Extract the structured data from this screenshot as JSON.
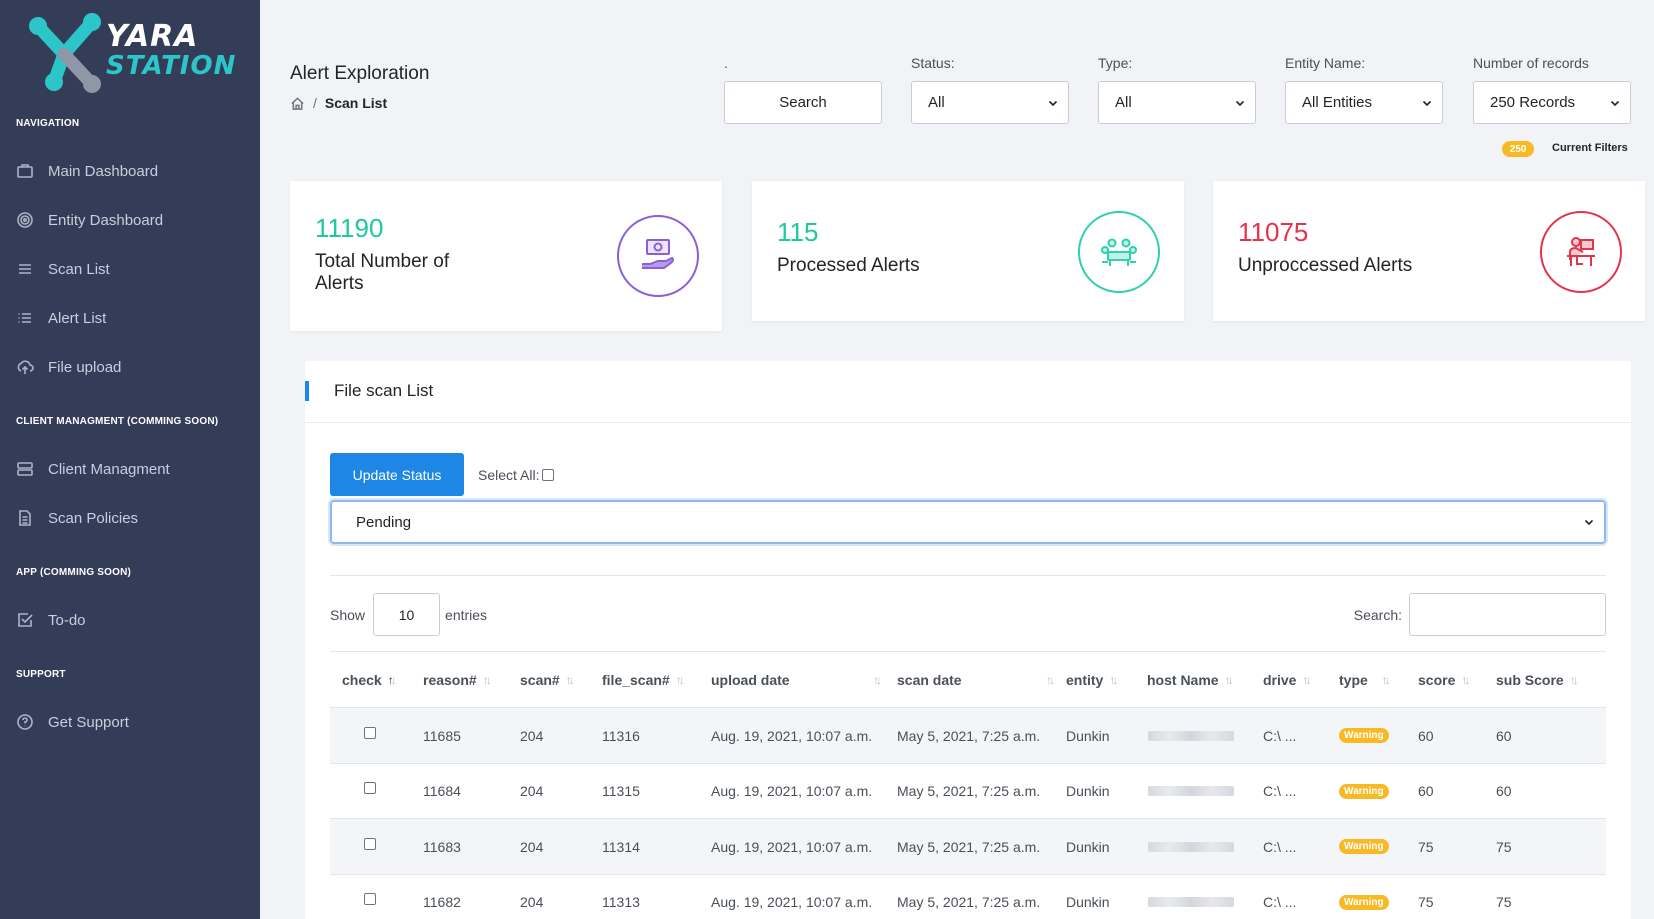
{
  "brand": {
    "name_top": "YARA",
    "name_bottom": "STATION",
    "teal": "#2cc6c9"
  },
  "sidebar": {
    "sections": [
      {
        "title": "NAVIGATION",
        "items": [
          {
            "label": "Main Dashboard",
            "icon": "monitor-icon"
          },
          {
            "label": "Entity Dashboard",
            "icon": "target-icon"
          },
          {
            "label": "Scan List",
            "icon": "list-icon"
          },
          {
            "label": "Alert List",
            "icon": "bullet-list-icon"
          },
          {
            "label": "File upload",
            "icon": "cloud-upload-icon"
          }
        ]
      },
      {
        "title": "CLIENT MANAGMENT (COMMING SOON)",
        "items": [
          {
            "label": "Client Managment",
            "icon": "server-icon"
          },
          {
            "label": "Scan Policies",
            "icon": "document-icon"
          }
        ]
      },
      {
        "title": "APP (COMMING SOON)",
        "items": [
          {
            "label": "To-do",
            "icon": "check-square-icon"
          }
        ]
      },
      {
        "title": "SUPPORT",
        "items": [
          {
            "label": "Get Support",
            "icon": "help-circle-icon"
          }
        ]
      }
    ]
  },
  "header": {
    "title": "Alert Exploration",
    "breadcrumb": {
      "separator": "/",
      "current": "Scan List"
    },
    "filters": {
      "search": {
        "label": ".",
        "button": "Search"
      },
      "status": {
        "label": "Status:",
        "value": "All"
      },
      "type": {
        "label": "Type:",
        "value": "All"
      },
      "entity": {
        "label": "Entity Name:",
        "value": "All Entities"
      },
      "records": {
        "label": "Number of records",
        "value": "250 Records"
      }
    },
    "record_count_badge": "250",
    "current_filters": "Current Filters"
  },
  "stats": {
    "total": {
      "number": "11190",
      "label": "Total Number of Alerts",
      "color": "#1fc8a0",
      "icon_color": "#8c5fd6"
    },
    "processed": {
      "number": "115",
      "label": "Processed Alerts",
      "color": "#1fc8a0",
      "icon_color": "#2fcfb0"
    },
    "unprocessed": {
      "number": "11075",
      "label": "Unproccessed Alerts",
      "color": "#e3344b",
      "icon_color": "#e3344b"
    }
  },
  "panel": {
    "title": "File scan List",
    "update_button": "Update Status",
    "select_all": "Select All:",
    "status_select": "Pending",
    "show": "Show",
    "entries_value": "10",
    "entries": "entries",
    "search_label": "Search:"
  },
  "table": {
    "columns": [
      "check",
      "reason#",
      "scan#",
      "file_scan#",
      "upload date",
      "scan date",
      "entity",
      "host Name",
      "drive",
      "type",
      "score",
      "sub Score"
    ],
    "rows": [
      {
        "reason": "11685",
        "scan": "204",
        "file_scan": "11316",
        "upload_date": "Aug. 19, 2021, 10:07 a.m.",
        "scan_date": "May 5, 2021, 7:25 a.m.",
        "entity": "Dunkin",
        "drive": "C:\\ ...",
        "type": "Warning",
        "score": "60",
        "sub_score": "60"
      },
      {
        "reason": "11684",
        "scan": "204",
        "file_scan": "11315",
        "upload_date": "Aug. 19, 2021, 10:07 a.m.",
        "scan_date": "May 5, 2021, 7:25 a.m.",
        "entity": "Dunkin",
        "drive": "C:\\ ...",
        "type": "Warning",
        "score": "60",
        "sub_score": "60"
      },
      {
        "reason": "11683",
        "scan": "204",
        "file_scan": "11314",
        "upload_date": "Aug. 19, 2021, 10:07 a.m.",
        "scan_date": "May 5, 2021, 7:25 a.m.",
        "entity": "Dunkin",
        "drive": "C:\\ ...",
        "type": "Warning",
        "score": "75",
        "sub_score": "75"
      },
      {
        "reason": "11682",
        "scan": "204",
        "file_scan": "11313",
        "upload_date": "Aug. 19, 2021, 10:07 a.m.",
        "scan_date": "May 5, 2021, 7:25 a.m.",
        "entity": "Dunkin",
        "drive": "C:\\ ...",
        "type": "Warning",
        "score": "75",
        "sub_score": "75"
      }
    ]
  }
}
